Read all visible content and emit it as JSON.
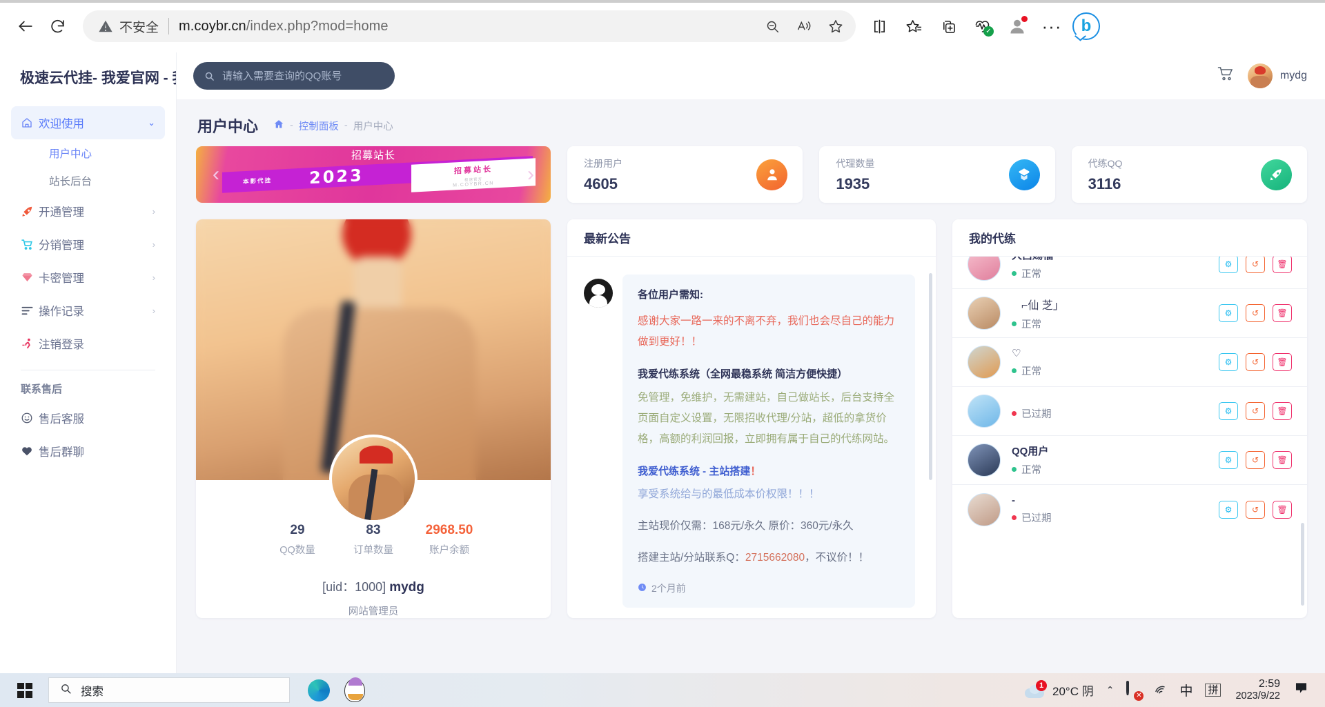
{
  "browser": {
    "back_label": "←",
    "reload_label": "⟳",
    "security_label": "不安全",
    "url_bold": "m.coybr.cn",
    "url_dim": "/index.php?mod=home",
    "omnibox_icons": [
      "zoom-out-icon",
      "read-aloud-icon",
      "favorite-star-icon"
    ],
    "toolbar_icons": [
      "split-screen-icon",
      "collections-icon",
      "add-tab-group-icon",
      "browser-essentials-icon",
      "profile-icon",
      "settings-more-icon",
      "bing-chat-icon"
    ],
    "bing_label": "b",
    "more_label": "···"
  },
  "sidebar": {
    "brand": "极速云代挂- 我爱官网 - 我",
    "items": [
      {
        "label": "欢迎使用",
        "icon": "home-icon",
        "caret": "⌄",
        "active": true
      },
      {
        "label": "开通管理",
        "icon": "rocket-icon",
        "caret": "›",
        "active": false
      },
      {
        "label": "分销管理",
        "icon": "cart-icon",
        "caret": "›",
        "active": false
      },
      {
        "label": "卡密管理",
        "icon": "diamond-icon",
        "caret": "›",
        "active": false
      },
      {
        "label": "操作记录",
        "icon": "list-icon",
        "caret": "›",
        "active": false
      },
      {
        "label": "注销登录",
        "icon": "runner-icon",
        "caret": "",
        "active": false
      }
    ],
    "sub_items": [
      {
        "label": "用户中心",
        "active": true
      },
      {
        "label": "站长后台",
        "active": false
      }
    ],
    "section_title": "联系售后",
    "support_items": [
      {
        "label": "售后客服",
        "icon": "smiley-icon"
      },
      {
        "label": "售后群聊",
        "icon": "heart-icon"
      }
    ]
  },
  "topbar": {
    "search_placeholder": "请输入需要查询的QQ账号",
    "search_value": "",
    "search_icon": "search-icon",
    "cart_icon": "shopping-cart-icon",
    "user_name": "mydg"
  },
  "page": {
    "title": "用户中心",
    "breadcrumb": {
      "home_icon": "home-icon",
      "sep": "-",
      "link": "控制面板",
      "current": "用户中心"
    }
  },
  "banner": {
    "top_text": "招募站长",
    "small_text": "本影代挂",
    "year": "2023",
    "box_title": "招募站长",
    "box_sub1": "极速官方",
    "box_sub2": "M.COYBR.CN",
    "prev_icon": "chevron-left-icon",
    "next_icon": "chevron-right-icon"
  },
  "stats": [
    {
      "label": "注册用户",
      "value": "4605",
      "icon": "user-icon",
      "color": "#f8883a"
    },
    {
      "label": "代理数量",
      "value": "1935",
      "icon": "badge-icon",
      "color": "#1ea7f0"
    },
    {
      "label": "代练QQ",
      "value": "3116",
      "icon": "rocket-icon",
      "color": "#2ec38d"
    }
  ],
  "profile": {
    "stats": [
      {
        "value": "29",
        "label": "QQ数量",
        "money": false
      },
      {
        "value": "83",
        "label": "订单数量",
        "money": false
      },
      {
        "value": "2968.50",
        "label": "账户余额",
        "money": true
      }
    ],
    "uid_prefix": "[uid：1000]",
    "uid_name": "mydg",
    "role": "网站管理员"
  },
  "announcement": {
    "title": "最新公告",
    "avatar_icon": "qq-penguin-icon",
    "heading": "各位用户需知:",
    "red_text": "感谢大家一路一来的不离不弃，我们也会尽自己的能力做到更好！！",
    "sub_heading": "我爱代练系统（全网最稳系统 简洁方便快捷）",
    "green_text": "免管理，免维护，无需建站，自己做站长，后台支持全页面自定义设置，无限招收代理/分站，超低的拿货价格，高额的利润回报，立即拥有属于自己的代练网站。",
    "blue_heading": "我爱代练系统 - 主站搭建",
    "blue_heading_ex": "！",
    "blue_text": "享受系统给与的最低成本价权限！！！",
    "price_line": "主站现价仅需：168元/永久  原价：360元/永久",
    "contact_prefix": "搭建主站/分站联系Q：",
    "contact_qq": "2715662080",
    "contact_suffix": "，不议价！！",
    "time_icon": "clock-icon",
    "time": "2个月前"
  },
  "my_list": {
    "title": "我的代练",
    "action_icons": [
      "gear-icon",
      "renew-icon",
      "trash-icon"
    ],
    "rows": [
      {
        "name": "大吕赐福",
        "status": "正常",
        "status_color": "#2ec38d",
        "fancy": false
      },
      {
        "name": "⌐仙 芝」",
        "status": "正常",
        "status_color": "#2ec38d",
        "fancy": true
      },
      {
        "name": "♡",
        "status": "正常",
        "status_color": "#2ec38d",
        "fancy": false
      },
      {
        "name": "",
        "status": "已过期",
        "status_color": "#f0364f",
        "fancy": false
      },
      {
        "name": "QQ用户",
        "status": "正常",
        "status_color": "#2ec38d",
        "fancy": false
      },
      {
        "name": "-",
        "status": "已过期",
        "status_color": "#f0364f",
        "fancy": false
      }
    ]
  },
  "taskbar": {
    "start_icon": "windows-start-icon",
    "search_placeholder": "搜索",
    "search_icon": "search-icon",
    "apps": [
      "edge-icon",
      "qq-icon"
    ],
    "weather_badge": "1",
    "weather_temp": "20°C",
    "weather_cond": "阴",
    "chevron_up": "⌃",
    "security_icon": "defender-shield-icon",
    "network_icon": "wifi-icon",
    "ime_mode": "中",
    "ime_pinyin": "拼",
    "time": "2:59",
    "date": "2023/9/22",
    "notification_icon": "notification-icon"
  }
}
